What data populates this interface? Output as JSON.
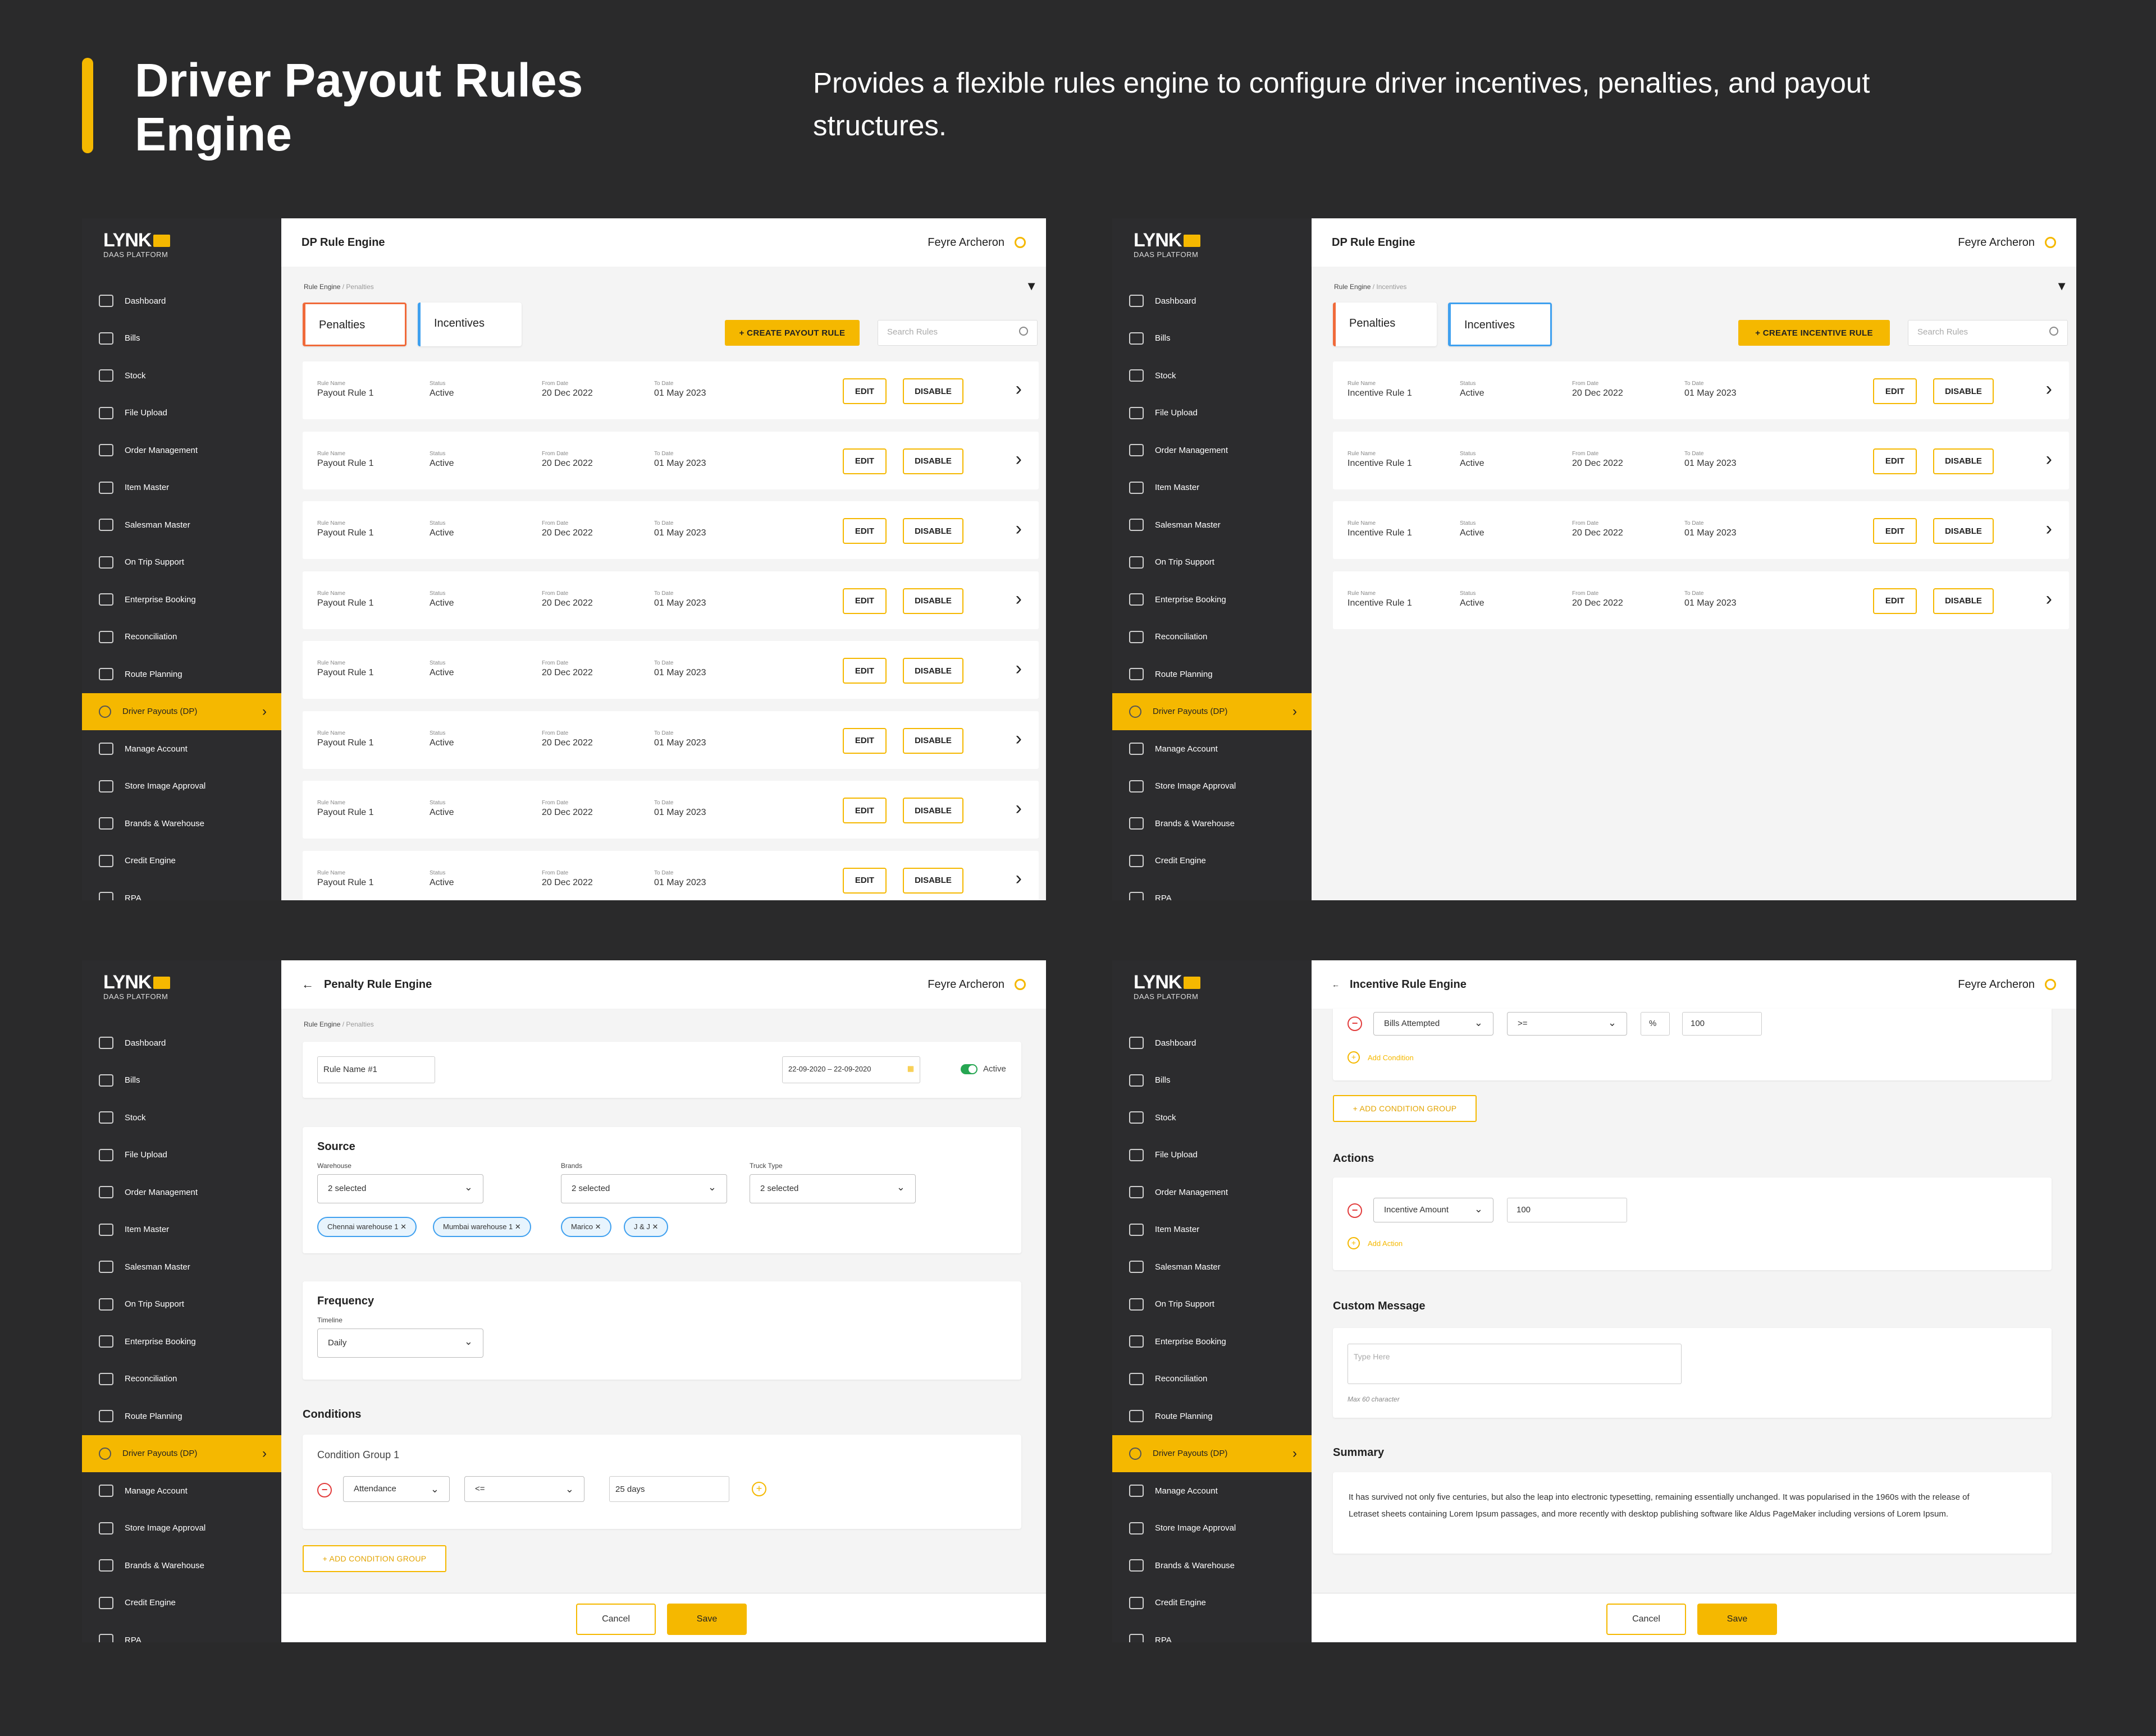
{
  "header": {
    "title": "Driver Payout Rules Engine",
    "description": "Provides a flexible rules engine to configure driver incentives, penalties, and payout structures."
  },
  "logo": {
    "brand": "LYNK",
    "sub": "DAAS PLATFORM"
  },
  "user": "Feyre Archeron",
  "nav": [
    "Dashboard",
    "Bills",
    "Stock",
    "File Upload",
    "Order Management",
    "Item Master",
    "Salesman Master",
    "On Trip Support",
    "Enterprise Booking",
    "Reconciliation",
    "Route Planning",
    "Driver Payouts (DP)",
    "Manage Account",
    "Store Image Approval",
    "Brands & Warehouse",
    "Credit Engine",
    "RPA"
  ],
  "list": {
    "title": "DP Rule Engine",
    "bc_root": "Rule Engine",
    "bc_pen": " / Penalties",
    "bc_inc": " / Incentives",
    "tab_pen": "Penalties",
    "tab_inc": "Incentives",
    "create_payout": "+ CREATE PAYOUT RULE",
    "create_incentive": "+ CREATE INCENTIVE RULE",
    "search_ph": "Search Rules",
    "lbl_name": "Rule Name",
    "lbl_status": "Status",
    "lbl_from": "From Date",
    "lbl_to": "To Date",
    "edit": "EDIT",
    "disable": "DISABLE",
    "pen_name": "Payout Rule 1",
    "inc_name": "Incentive Rule 1",
    "status": "Active",
    "from": "20 Dec 2022",
    "to": "01 May 2023"
  },
  "penalty": {
    "title": "Penalty Rule Engine",
    "bc_root": "Rule Engine",
    "bc_sub": " / Penalties",
    "rule_name": "Rule Name #1",
    "date_range": "22-09-2020 – 22-09-2020",
    "active": "Active",
    "source": "Source",
    "warehouse": "Warehouse",
    "brands": "Brands",
    "truck": "Truck Type",
    "sel2": "2 selected",
    "chips": [
      "Chennai warehouse 1",
      "Mumbai warehouse 1",
      "Marico",
      "J & J"
    ],
    "frequency": "Frequency",
    "timeline": "Timeline",
    "daily": "Daily",
    "conditions": "Conditions",
    "group": "Condition Group 1",
    "attendance": "Attendance",
    "op": "<=",
    "days": "25 days",
    "add_group": "+ ADD CONDITION GROUP",
    "cancel": "Cancel",
    "save": "Save"
  },
  "incentive": {
    "title": "Incentive Rule Engine",
    "bills": "Bills Attempted",
    "op": ">=",
    "pct": "%",
    "val": "100",
    "add_condition": "Add Condition",
    "add_group": "+ ADD CONDITION GROUP",
    "actions": "Actions",
    "amount": "Incentive Amount",
    "amount_val": "100",
    "add_action": "Add Action",
    "custom": "Custom Message",
    "type_here": "Type Here",
    "max": "Max 60 character",
    "summary": "Summary",
    "summary_text": "It has survived not only five centuries, but also the leap into electronic typesetting, remaining essentially unchanged. It was popularised in the 1960s with the release of Letraset sheets containing Lorem Ipsum passages, and more recently with desktop publishing software like Aldus PageMaker including versions of Lorem Ipsum.",
    "cancel": "Cancel",
    "save": "Save"
  },
  "colors": {
    "accent": "#f5b800",
    "sidebar": "#2c2c2e",
    "penalty": "#f06a3a",
    "incentive": "#3fa0ef"
  }
}
